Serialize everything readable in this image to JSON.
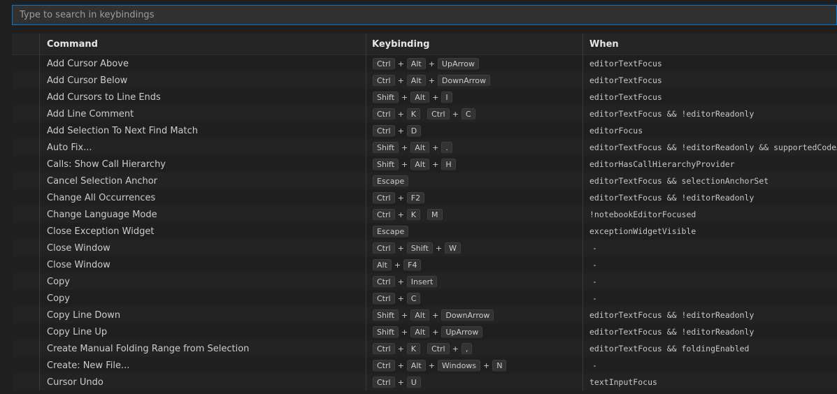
{
  "search": {
    "placeholder": "Type to search in keybindings"
  },
  "columns": {
    "command": "Command",
    "keybinding": "Keybinding",
    "when": "When"
  },
  "rows": [
    {
      "command": "Add Cursor Above",
      "chords": [
        [
          "Ctrl",
          "Alt",
          "UpArrow"
        ]
      ],
      "when": "editorTextFocus"
    },
    {
      "command": "Add Cursor Below",
      "chords": [
        [
          "Ctrl",
          "Alt",
          "DownArrow"
        ]
      ],
      "when": "editorTextFocus"
    },
    {
      "command": "Add Cursors to Line Ends",
      "chords": [
        [
          "Shift",
          "Alt",
          "I"
        ]
      ],
      "when": "editorTextFocus"
    },
    {
      "command": "Add Line Comment",
      "chords": [
        [
          "Ctrl",
          "K"
        ],
        [
          "Ctrl",
          "C"
        ]
      ],
      "when": "editorTextFocus && !editorReadonly"
    },
    {
      "command": "Add Selection To Next Find Match",
      "chords": [
        [
          "Ctrl",
          "D"
        ]
      ],
      "when": "editorFocus"
    },
    {
      "command": "Auto Fix...",
      "chords": [
        [
          "Shift",
          "Alt",
          "."
        ]
      ],
      "when": "editorTextFocus && !editorReadonly && supportedCodeActi"
    },
    {
      "command": "Calls: Show Call Hierarchy",
      "chords": [
        [
          "Shift",
          "Alt",
          "H"
        ]
      ],
      "when": "editorHasCallHierarchyProvider"
    },
    {
      "command": "Cancel Selection Anchor",
      "chords": [
        [
          "Escape"
        ]
      ],
      "when": "editorTextFocus && selectionAnchorSet"
    },
    {
      "command": "Change All Occurrences",
      "chords": [
        [
          "Ctrl",
          "F2"
        ]
      ],
      "when": "editorTextFocus && !editorReadonly"
    },
    {
      "command": "Change Language Mode",
      "chords": [
        [
          "Ctrl",
          "K"
        ],
        [
          "M"
        ]
      ],
      "when": "!notebookEditorFocused"
    },
    {
      "command": "Close Exception Widget",
      "chords": [
        [
          "Escape"
        ]
      ],
      "when": "exceptionWidgetVisible"
    },
    {
      "command": "Close Window",
      "chords": [
        [
          "Ctrl",
          "Shift",
          "W"
        ]
      ],
      "when": "-"
    },
    {
      "command": "Close Window",
      "chords": [
        [
          "Alt",
          "F4"
        ]
      ],
      "when": "-"
    },
    {
      "command": "Copy",
      "chords": [
        [
          "Ctrl",
          "Insert"
        ]
      ],
      "when": "-"
    },
    {
      "command": "Copy",
      "chords": [
        [
          "Ctrl",
          "C"
        ]
      ],
      "when": "-"
    },
    {
      "command": "Copy Line Down",
      "chords": [
        [
          "Shift",
          "Alt",
          "DownArrow"
        ]
      ],
      "when": "editorTextFocus && !editorReadonly"
    },
    {
      "command": "Copy Line Up",
      "chords": [
        [
          "Shift",
          "Alt",
          "UpArrow"
        ]
      ],
      "when": "editorTextFocus && !editorReadonly"
    },
    {
      "command": "Create Manual Folding Range from Selection",
      "chords": [
        [
          "Ctrl",
          "K"
        ],
        [
          "Ctrl",
          ","
        ]
      ],
      "when": "editorTextFocus && foldingEnabled"
    },
    {
      "command": "Create: New File...",
      "chords": [
        [
          "Ctrl",
          "Alt",
          "Windows",
          "N"
        ]
      ],
      "when": "-"
    },
    {
      "command": "Cursor Undo",
      "chords": [
        [
          "Ctrl",
          "U"
        ]
      ],
      "when": "textInputFocus"
    }
  ],
  "colors": {
    "background": "#1f1f1f",
    "focus_border": "#0078d4",
    "row_alt": "#232323",
    "kbd_bg": "#333333"
  }
}
